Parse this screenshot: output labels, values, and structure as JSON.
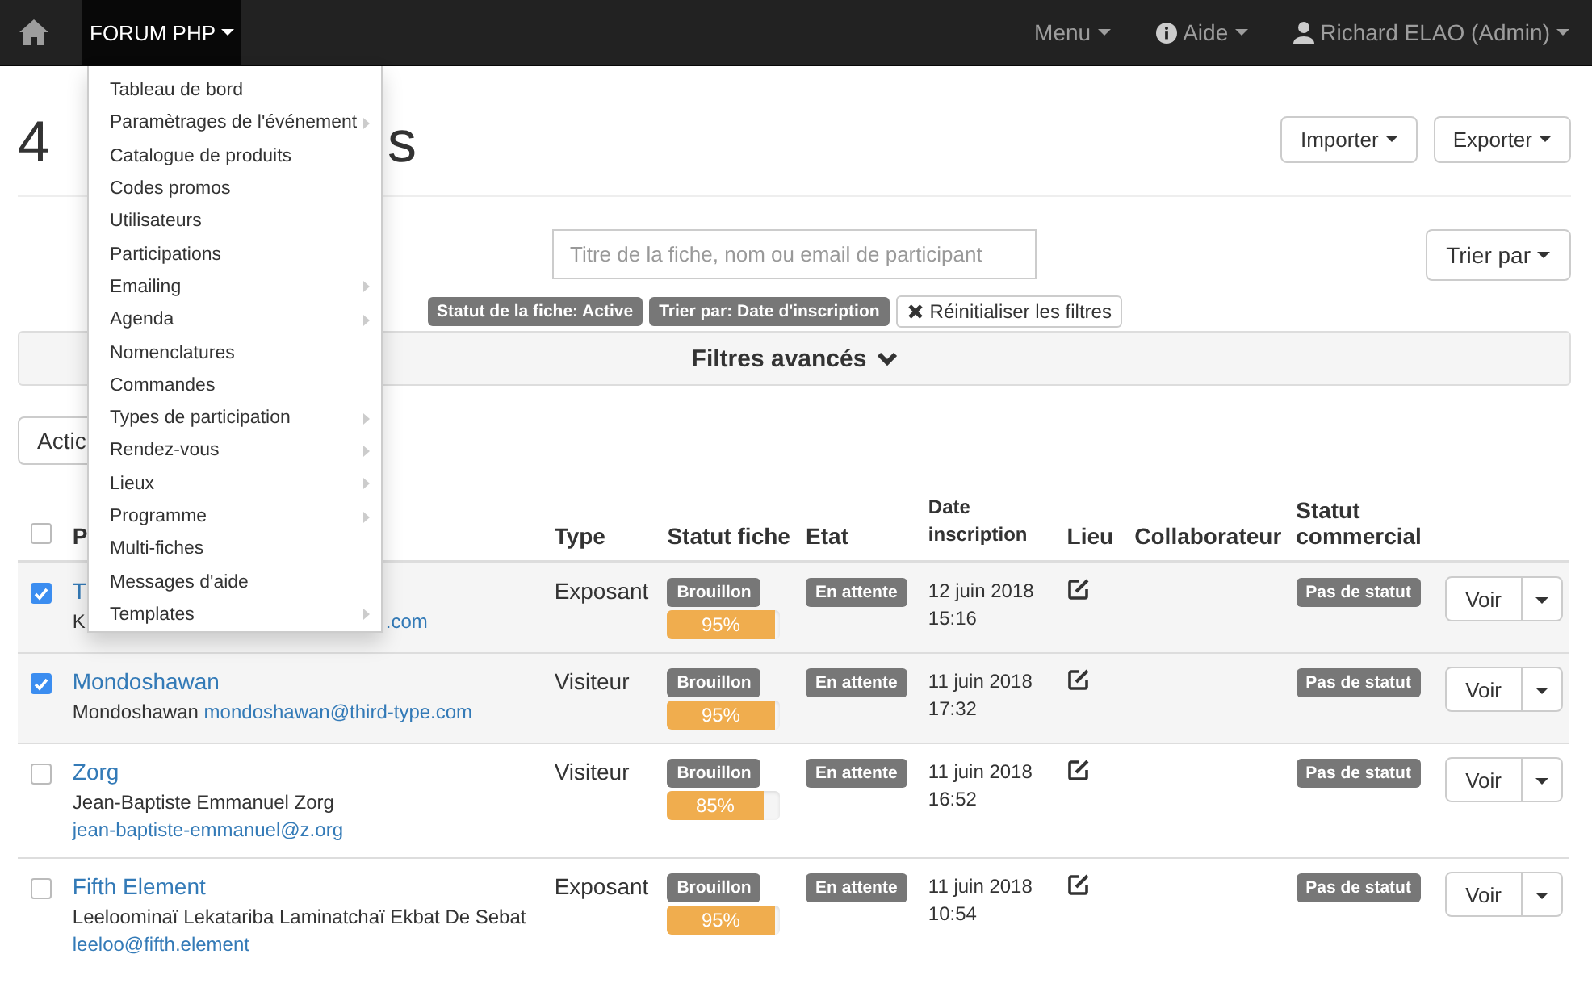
{
  "navbar": {
    "brand": "FORUM PHP",
    "right": [
      {
        "kind": "menu",
        "label": "Menu"
      },
      {
        "kind": "info",
        "label": "Aide"
      },
      {
        "kind": "user",
        "label": "Richard ELAO (Admin)"
      }
    ]
  },
  "dropdown": [
    {
      "label": "Tableau de bord",
      "submenu": false
    },
    {
      "label": "Paramètrages de l'événement",
      "submenu": true
    },
    {
      "label": "Catalogue de produits",
      "submenu": false
    },
    {
      "label": "Codes promos",
      "submenu": false
    },
    {
      "label": "Utilisateurs",
      "submenu": false
    },
    {
      "label": "Participations",
      "submenu": false
    },
    {
      "label": "Emailing",
      "submenu": true
    },
    {
      "label": "Agenda",
      "submenu": true
    },
    {
      "label": "Nomenclatures",
      "submenu": false
    },
    {
      "label": "Commandes",
      "submenu": false
    },
    {
      "label": "Types de participation",
      "submenu": true
    },
    {
      "label": "Rendez-vous",
      "submenu": true
    },
    {
      "label": "Lieux",
      "submenu": true
    },
    {
      "label": "Programme",
      "submenu": true
    },
    {
      "label": "Multi-fiches",
      "submenu": false
    },
    {
      "label": "Messages d'aide",
      "submenu": false
    },
    {
      "label": "Templates",
      "submenu": true
    }
  ],
  "title": {
    "start": "4",
    "end": "s"
  },
  "buttons": [
    "Importer",
    "Exporter"
  ],
  "search": {
    "placeholder": "Titre de la fiche, nom ou email de participant"
  },
  "sort_button": "Trier par",
  "filters": [
    "Statut de la fiche: Active",
    "Trier par: Date d'inscription"
  ],
  "reset_button": "Réinitialiser les filtres",
  "advanced_filters": "Filtres avancés",
  "action_button": "Actic",
  "table": {
    "select_all": false,
    "columns": [
      "P",
      "Type",
      "Statut fiche",
      "Etat",
      "Date inscription",
      "Lieu",
      "Collaborateur",
      "Statut commercial"
    ],
    "rows": [
      {
        "selected": true,
        "kind": "covered",
        "name": "T",
        "person": "K",
        "email": ".com",
        "type": "Exposant",
        "status": "Brouillon",
        "level": 0.95,
        "progress": "95%",
        "state": "En attente",
        "date": "12 juin 2018",
        "time": "15:16",
        "commercial": "Pas de statut",
        "action": "Voir"
      },
      {
        "selected": true,
        "kind": "full",
        "name": "Mondoshawan",
        "person": "Mondoshawan",
        "email": "mondoshawan@third-type.com",
        "type": "Visiteur",
        "status": "Brouillon",
        "level": 0.95,
        "progress": "95%",
        "state": "En attente",
        "date": "11 juin 2018",
        "time": "17:32",
        "commercial": "Pas de statut",
        "action": "Voir"
      },
      {
        "selected": false,
        "kind": "full",
        "name": "Zorg",
        "person": "Jean-Baptiste Emmanuel Zorg",
        "email": "jean-baptiste-emmanuel@z.org",
        "type": "Visiteur",
        "status": "Brouillon",
        "level": 0.85,
        "progress": "85%",
        "state": "En attente",
        "date": "11 juin 2018",
        "time": "16:52",
        "commercial": "Pas de statut",
        "action": "Voir"
      },
      {
        "selected": false,
        "kind": "full",
        "name": "Fifth Element",
        "person": "Leeloominaï Lekatariba Laminatchaï Ekbat De Sebat",
        "email": "leeloo@fifth.element",
        "type": "Exposant",
        "status": "Brouillon",
        "level": 0.95,
        "progress": "95%",
        "state": "En attente",
        "date": "11 juin 2018",
        "time": "10:54",
        "commercial": "Pas de statut",
        "action": "Voir"
      }
    ]
  }
}
